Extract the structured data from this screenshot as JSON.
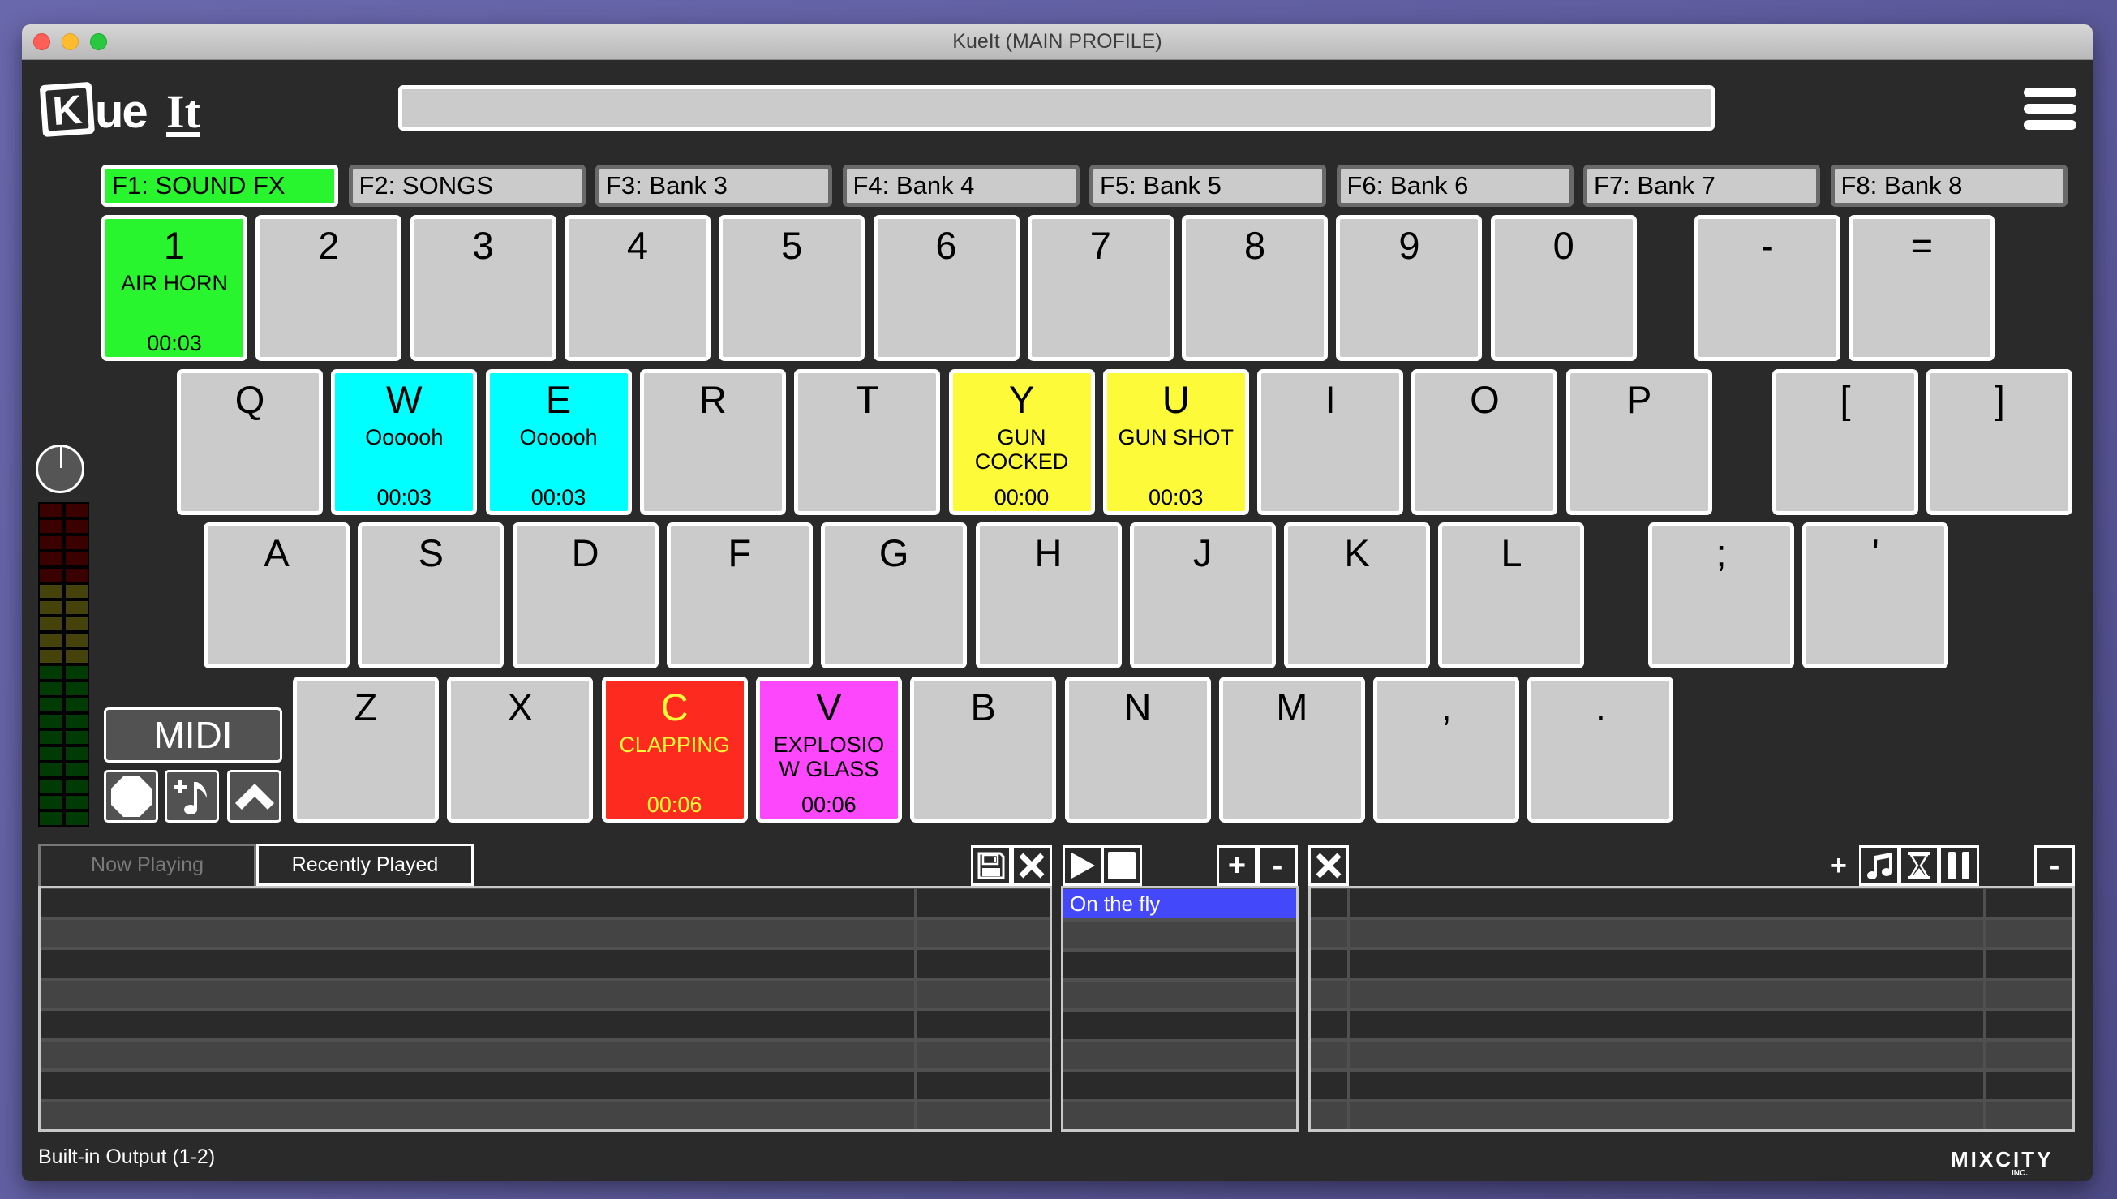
{
  "window": {
    "title": "KueIt (MAIN PROFILE)"
  },
  "logo": {
    "text": "KueIt"
  },
  "search": {
    "value": "",
    "placeholder": ""
  },
  "banks": [
    {
      "label": "F1: SOUND FX",
      "active": true
    },
    {
      "label": "F2: SONGS",
      "active": false
    },
    {
      "label": "F3: Bank 3",
      "active": false
    },
    {
      "label": "F4: Bank 4",
      "active": false
    },
    {
      "label": "F5: Bank 5",
      "active": false
    },
    {
      "label": "F6: Bank 6",
      "active": false
    },
    {
      "label": "F7: Bank 7",
      "active": false
    },
    {
      "label": "F8: Bank 8",
      "active": false
    }
  ],
  "keyboard": {
    "rows": [
      [
        {
          "key": "1",
          "name": "AIR HORN",
          "time": "00:03",
          "color": "#28f52e",
          "text_color": "#000000"
        },
        {
          "key": "2"
        },
        {
          "key": "3"
        },
        {
          "key": "4"
        },
        {
          "key": "5"
        },
        {
          "key": "6"
        },
        {
          "key": "7"
        },
        {
          "key": "8"
        },
        {
          "key": "9"
        },
        {
          "key": "0"
        },
        {
          "key": "-",
          "gap_before": true
        },
        {
          "key": "="
        }
      ],
      [
        {
          "key": "Q"
        },
        {
          "key": "W",
          "name": "Oooooh",
          "time": "00:03",
          "color": "#00ffff",
          "text_color": "#000000"
        },
        {
          "key": "E",
          "name": "Oooooh",
          "time": "00:03",
          "color": "#00ffff",
          "text_color": "#000000"
        },
        {
          "key": "R"
        },
        {
          "key": "T"
        },
        {
          "key": "Y",
          "name": "GUN COCKED",
          "time": "00:00",
          "color": "#fdfa3a",
          "text_color": "#000000"
        },
        {
          "key": "U",
          "name": "GUN SHOT",
          "time": "00:03",
          "color": "#fdfa3a",
          "text_color": "#000000"
        },
        {
          "key": "I"
        },
        {
          "key": "O"
        },
        {
          "key": "P"
        },
        {
          "key": "[",
          "gap_before": true
        },
        {
          "key": "]"
        }
      ],
      [
        {
          "key": "A"
        },
        {
          "key": "S"
        },
        {
          "key": "D"
        },
        {
          "key": "F"
        },
        {
          "key": "G"
        },
        {
          "key": "H"
        },
        {
          "key": "J"
        },
        {
          "key": "K"
        },
        {
          "key": "L"
        },
        {
          "key": ";",
          "gap_before": true
        },
        {
          "key": "'"
        }
      ],
      [
        {
          "key": "Z"
        },
        {
          "key": "X"
        },
        {
          "key": "C",
          "name": "CLAPPING",
          "time": "00:06",
          "color": "#fd2a1f",
          "text_color": "#fdfa3a"
        },
        {
          "key": "V",
          "name": "EXPLOSIO W GLASS",
          "time": "00:06",
          "color": "#fd47fc",
          "text_color": "#000000"
        },
        {
          "key": "B"
        },
        {
          "key": "N"
        },
        {
          "key": "M"
        },
        {
          "key": ","
        },
        {
          "key": "."
        }
      ]
    ]
  },
  "controls": {
    "volume_knob_icon": "knob-icon",
    "meter": {
      "segments": 20,
      "red": 5,
      "yellow": 5,
      "green": 10,
      "lit_level": 0
    },
    "midi_label": "MIDI",
    "buttons": [
      {
        "name": "stop-all-button",
        "icon": "octagon-stop-icon"
      },
      {
        "name": "add-sound-button",
        "icon": "add-music-note-icon"
      },
      {
        "name": "collapse-button",
        "icon": "chevron-up-icon"
      }
    ]
  },
  "bottom": {
    "tabs": [
      {
        "label": "Now Playing",
        "active": false
      },
      {
        "label": "Recently Played",
        "active": true
      }
    ],
    "left_toolbar": [
      {
        "icon": "save-icon"
      },
      {
        "icon": "close-x-icon"
      }
    ],
    "playlist_toolbar": [
      {
        "icon": "play-icon"
      },
      {
        "icon": "stop-icon"
      },
      {
        "label": "+"
      },
      {
        "label": "-"
      }
    ],
    "playlists": [
      "On the fly"
    ],
    "right_toolbar": {
      "plus_label": "+",
      "buttons": [
        {
          "icon": "music-note-icon"
        },
        {
          "icon": "hourglass-icon"
        },
        {
          "icon": "pause-icon"
        }
      ],
      "minus_label": "-",
      "close_icon": "close-x-icon"
    },
    "left_table_rows": 8,
    "right_table_rows": 8
  },
  "footer": {
    "output_device": "Built-in Output (1-2)",
    "brand": "MIXCITY",
    "brand_sub": "INC."
  },
  "colors": {
    "bg": "#2a2a2a",
    "key": "#cbcbcb",
    "active_bank": "#28f52e",
    "selection": "#4348fb"
  }
}
